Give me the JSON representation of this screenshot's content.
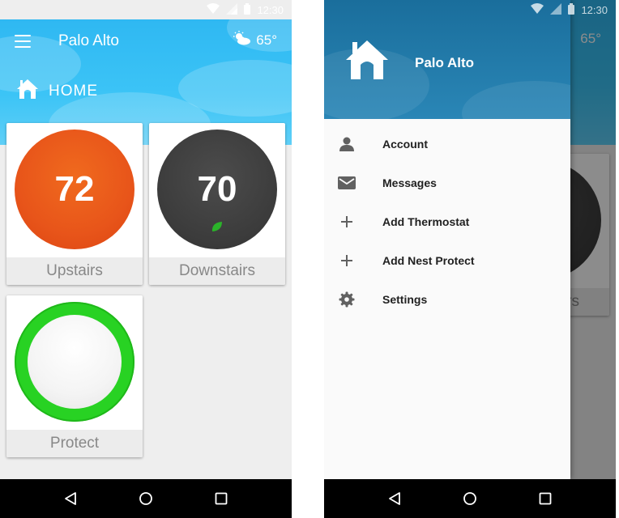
{
  "status": {
    "time": "12:30"
  },
  "header": {
    "location": "Palo Alto",
    "temperature": "65°",
    "section": "HOME"
  },
  "devices": [
    {
      "label": "Upstairs",
      "temp": "72",
      "mode": "heating",
      "color": "#e8551a"
    },
    {
      "label": "Downstairs",
      "temp": "70",
      "mode": "eco",
      "color": "#3b3b3b"
    },
    {
      "label": "Protect",
      "mode": "ok",
      "color": "#28d223"
    }
  ],
  "drawer": {
    "title": "Palo Alto",
    "items": [
      {
        "label": "Account",
        "icon": "person-icon"
      },
      {
        "label": "Messages",
        "icon": "mail-icon"
      },
      {
        "label": "Add Thermostat",
        "icon": "plus-icon"
      },
      {
        "label": "Add Nest Protect",
        "icon": "plus-icon"
      },
      {
        "label": "Settings",
        "icon": "gear-icon"
      }
    ]
  },
  "colors": {
    "appbar": "#2fb8f2",
    "drawer_header": "#1a6e9c",
    "heating": "#e8551a",
    "protect_ok": "#28d223",
    "leaf": "#2bb32a"
  }
}
